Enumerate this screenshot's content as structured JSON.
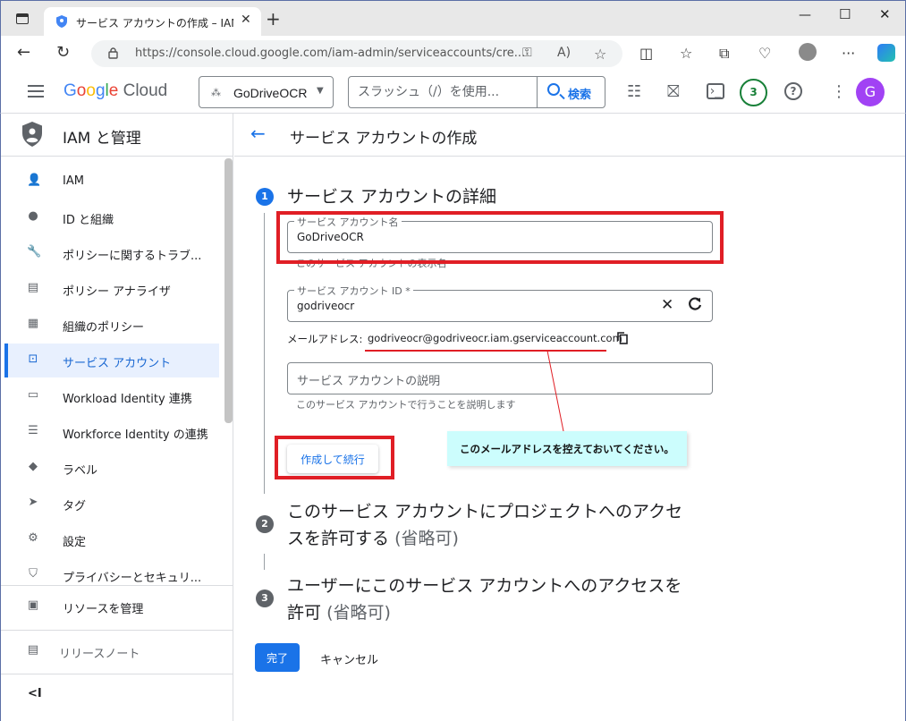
{
  "browser": {
    "tab_title": "サービス アカウントの作成 – IAM と管",
    "url": "https://console.cloud.google.com/iam-admin/serviceaccounts/cre..."
  },
  "header": {
    "logo_google": "Google",
    "logo_cloud": "Cloud",
    "project": "GoDriveOCR",
    "search_placeholder": "スラッシュ（/）を使用...",
    "search_button": "検索",
    "notifications_count": "3",
    "help": "?",
    "avatar_initial": "G"
  },
  "sidebar": {
    "title": "IAM と管理",
    "items": [
      {
        "label": "IAM",
        "icon": "person-add-icon"
      },
      {
        "label": "ID と組織",
        "icon": "account-circle-icon"
      },
      {
        "label": "ポリシーに関するトラブ...",
        "icon": "wrench-icon"
      },
      {
        "label": "ポリシー アナライザ",
        "icon": "document-search-icon"
      },
      {
        "label": "組織のポリシー",
        "icon": "list-document-icon"
      },
      {
        "label": "サービス アカウント",
        "icon": "service-account-icon"
      },
      {
        "label": "Workload Identity 連携",
        "icon": "id-card-icon"
      },
      {
        "label": "Workforce Identity の連携",
        "icon": "list-icon"
      },
      {
        "label": "ラベル",
        "icon": "label-icon"
      },
      {
        "label": "タグ",
        "icon": "tag-icon"
      },
      {
        "label": "設定",
        "icon": "gear-icon"
      },
      {
        "label": "プライバシーとセキュリ...",
        "icon": "shield-icon"
      }
    ],
    "manage_resources": "リソースを管理",
    "release_notes": "リリースノート",
    "collapse": "<I"
  },
  "main": {
    "page_title": "サービス アカウントの作成",
    "step1": {
      "num": "1",
      "title": "サービス アカウントの詳細",
      "name_label": "サービス アカウント名",
      "name_value": "GoDriveOCR",
      "name_hint": "このサービス アカウントの表示名",
      "id_label": "サービス アカウント ID *",
      "id_value": "godriveocr",
      "email_label": "メールアドレス:",
      "email_value": "godriveocr@godriveocr.iam.gserviceaccount.com",
      "desc_placeholder": "サービス アカウントの説明",
      "desc_hint": "このサービス アカウントで行うことを説明します",
      "continue_button": "作成して続行"
    },
    "step2": {
      "num": "2",
      "title_line1": "このサービス アカウントにプロジェクトへのアクセ",
      "title_line2": "スを許可する",
      "optional": "(省略可)"
    },
    "step3": {
      "num": "3",
      "title_line1": "ユーザーにこのサービス アカウントへのアクセスを",
      "title_line2": "許可",
      "optional": "(省略可)"
    },
    "done_button": "完了",
    "cancel_button": "キャンセル"
  },
  "annotation": {
    "callout_text": "このメールアドレスを控えておいてください。",
    "color": "#e01e25"
  }
}
